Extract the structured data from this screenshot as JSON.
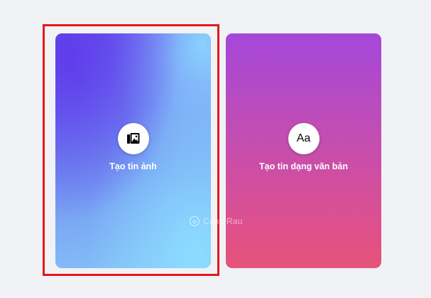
{
  "cards": {
    "photo": {
      "label": "Tạo tin ảnh",
      "icon": "photo-gallery-icon"
    },
    "text": {
      "label": "Tạo tin dạng văn bản",
      "icon_text": "Aa"
    }
  },
  "watermark": {
    "text": "Canh Rau"
  },
  "colors": {
    "page_background": "#f0f2f5",
    "highlight_border": "#e0191c",
    "photo_card_gradient": [
      "#5f3ceb",
      "#86c3f8"
    ],
    "text_card_gradient": [
      "#a447da",
      "#e6527a"
    ]
  }
}
